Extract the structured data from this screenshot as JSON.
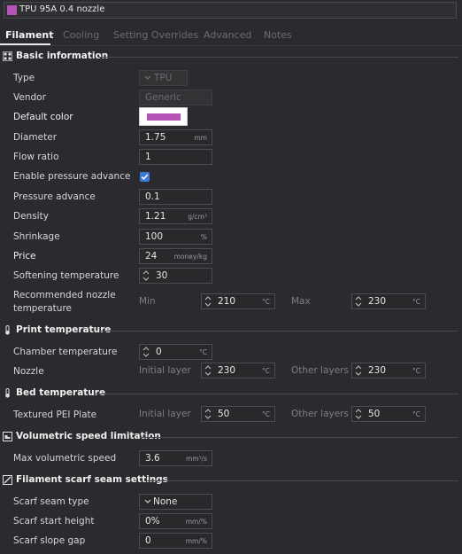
{
  "preset": {
    "name": "TPU 95A 0.4 nozzle",
    "swatch_color": "#b552b5"
  },
  "tabs": [
    "Filament",
    "Cooling",
    "Setting Overrides",
    "Advanced",
    "Notes"
  ],
  "active_tab": "Filament",
  "sections": {
    "basic": "Basic information",
    "print_temp": "Print temperature",
    "bed_temp": "Bed temperature",
    "volumetric": "Volumetric speed limitation",
    "scarf": "Filament scarf seam settings"
  },
  "basic": {
    "type": {
      "label": "Type",
      "value": "TPU"
    },
    "vendor": {
      "label": "Vendor",
      "value": "Generic"
    },
    "default_color": {
      "label": "Default color",
      "value": "#b552b5"
    },
    "diameter": {
      "label": "Diameter",
      "value": "1.75",
      "unit": "mm"
    },
    "flow_ratio": {
      "label": "Flow ratio",
      "value": "1"
    },
    "pressure_adv_enable": {
      "label": "Enable pressure advance",
      "checked": true
    },
    "pressure_advance": {
      "label": "Pressure advance",
      "value": "0.1"
    },
    "density": {
      "label": "Density",
      "value": "1.21",
      "unit": "g/cm³"
    },
    "shrinkage": {
      "label": "Shrinkage",
      "value": "100",
      "unit": "%"
    },
    "price": {
      "label": "Price",
      "value": "24",
      "unit": "money/kg"
    },
    "softening": {
      "label": "Softening temperature",
      "value": "30"
    },
    "nozzle_temp": {
      "label_line1": "Recommended nozzle",
      "label_line2": "temperature",
      "min_label": "Min",
      "min": "210",
      "max_label": "Max",
      "max": "230",
      "unit": "°C"
    }
  },
  "print_temp": {
    "chamber": {
      "label": "Chamber temperature",
      "value": "0",
      "unit": "°C"
    },
    "nozzle": {
      "label": "Nozzle",
      "initial_label": "Initial layer",
      "initial": "230",
      "other_label": "Other layers",
      "other": "230",
      "unit": "°C"
    }
  },
  "bed_temp": {
    "plate": {
      "label": "Textured PEI Plate",
      "initial_label": "Initial layer",
      "initial": "50",
      "other_label": "Other layers",
      "other": "50",
      "unit": "°C"
    }
  },
  "volumetric": {
    "max": {
      "label": "Max volumetric speed",
      "value": "3.6",
      "unit": "mm³/s"
    }
  },
  "scarf": {
    "seam_type": {
      "label": "Scarf seam type",
      "value": "None"
    },
    "start_height": {
      "label": "Scarf start height",
      "value": "0%",
      "unit": "mm/%"
    },
    "slope_gap": {
      "label": "Scarf slope gap",
      "value": "0",
      "unit": "mm/%"
    }
  }
}
